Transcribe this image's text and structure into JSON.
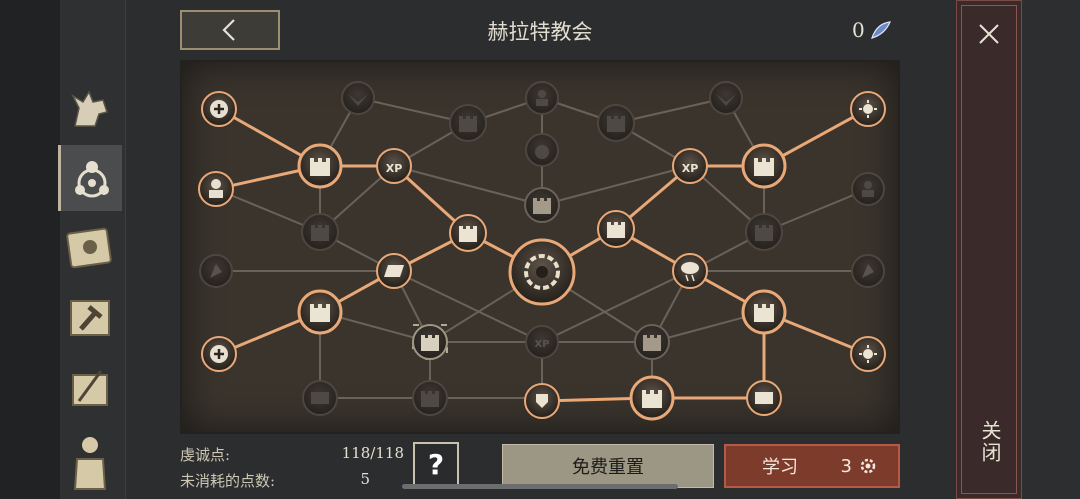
{
  "header": {
    "title": "赫拉特教会",
    "currency_value": "0",
    "back_icon": "chevron-left-icon",
    "currency_icon": "feather-gem-icon"
  },
  "sidebar": {
    "tabs": [
      {
        "icon": "wolf-icon",
        "active": false
      },
      {
        "icon": "atom-emblem-icon",
        "active": true
      },
      {
        "icon": "sun-book-icon",
        "active": false
      },
      {
        "icon": "hammer-scroll-icon",
        "active": false
      },
      {
        "icon": "quill-scroll-icon",
        "active": false
      },
      {
        "icon": "soldier-icon",
        "active": false
      }
    ]
  },
  "close": {
    "icon": "close-icon",
    "vertical_label": "关闭"
  },
  "footer": {
    "devotion_label": "虔诚点:",
    "devotion_value": "118/118",
    "unspent_label": "未消耗的点数:",
    "unspent_value": "5",
    "help_label": "?",
    "reset_label": "免费重置",
    "learn_label": "学习",
    "learn_cost": "3"
  },
  "colors": {
    "active_link": "#e9a877",
    "inactive_link": "#6a625a",
    "board_bg": "#3a342d",
    "learn_button": "#7d3b2c"
  },
  "tree": {
    "nodes": [
      {
        "id": "center",
        "icon": "sun-vortex-icon",
        "state": "active"
      },
      {
        "id": "l-plus-top",
        "icon": "plus-icon",
        "state": "active"
      },
      {
        "id": "l-plus-bottom",
        "icon": "plus-icon",
        "state": "active"
      },
      {
        "id": "l-soldier",
        "icon": "soldier-bust-icon",
        "state": "active"
      },
      {
        "id": "l-flag",
        "icon": "flag-icon",
        "state": "locked"
      },
      {
        "id": "l-tower-1",
        "icon": "tower-icon",
        "state": "active"
      },
      {
        "id": "l-tower-2",
        "icon": "tower-icon",
        "state": "locked"
      },
      {
        "id": "l-tower-3",
        "icon": "tower-icon",
        "state": "active"
      },
      {
        "id": "l-bar",
        "icon": "ingot-icon",
        "state": "active"
      },
      {
        "id": "l-xp",
        "icon": "xp-icon",
        "state": "active"
      },
      {
        "id": "l-tower-4",
        "icon": "tower-icon",
        "state": "active"
      },
      {
        "id": "l-tower-sel",
        "icon": "tower-icon",
        "state": "selected"
      },
      {
        "id": "l-chest",
        "icon": "chest-icon",
        "state": "locked"
      },
      {
        "id": "l-tower-5",
        "icon": "tower-icon",
        "state": "locked"
      },
      {
        "id": "top-eagle-l",
        "icon": "eagle-icon",
        "state": "locked"
      },
      {
        "id": "top-tower-l",
        "icon": "tower-icon",
        "state": "locked"
      },
      {
        "id": "top-soldier",
        "icon": "soldier-bust-icon",
        "state": "locked"
      },
      {
        "id": "top-tower-r",
        "icon": "tower-icon",
        "state": "locked"
      },
      {
        "id": "top-eagle-r",
        "icon": "eagle-icon",
        "state": "locked"
      },
      {
        "id": "mid-pot",
        "icon": "pot-icon",
        "state": "locked"
      },
      {
        "id": "mid-tower",
        "icon": "tower-icon",
        "state": "locked"
      },
      {
        "id": "mid-xp",
        "icon": "xp-icon",
        "state": "locked"
      },
      {
        "id": "b-shield",
        "icon": "shield-speed-icon",
        "state": "active"
      },
      {
        "id": "b-tower",
        "icon": "tower-icon",
        "state": "active"
      },
      {
        "id": "r-chest",
        "icon": "chest-icon",
        "state": "active"
      },
      {
        "id": "r-tower-1",
        "icon": "tower-icon",
        "state": "active"
      },
      {
        "id": "r-tower-2",
        "icon": "tower-icon",
        "state": "active"
      },
      {
        "id": "r-tower-3",
        "icon": "tower-icon",
        "state": "active"
      },
      {
        "id": "r-tower-4",
        "icon": "tower-icon",
        "state": "locked"
      },
      {
        "id": "r-tower-5",
        "icon": "tower-icon",
        "state": "locked"
      },
      {
        "id": "r-xp",
        "icon": "xp-icon",
        "state": "active"
      },
      {
        "id": "r-cloud",
        "icon": "storm-cloud-icon",
        "state": "active"
      },
      {
        "id": "r-sun-top",
        "icon": "sun-icon",
        "state": "active"
      },
      {
        "id": "r-sun-bottom",
        "icon": "sun-icon",
        "state": "active"
      },
      {
        "id": "r-soldier",
        "icon": "soldier-bust-icon",
        "state": "locked"
      },
      {
        "id": "r-flag",
        "icon": "flag-icon",
        "state": "locked"
      }
    ]
  }
}
